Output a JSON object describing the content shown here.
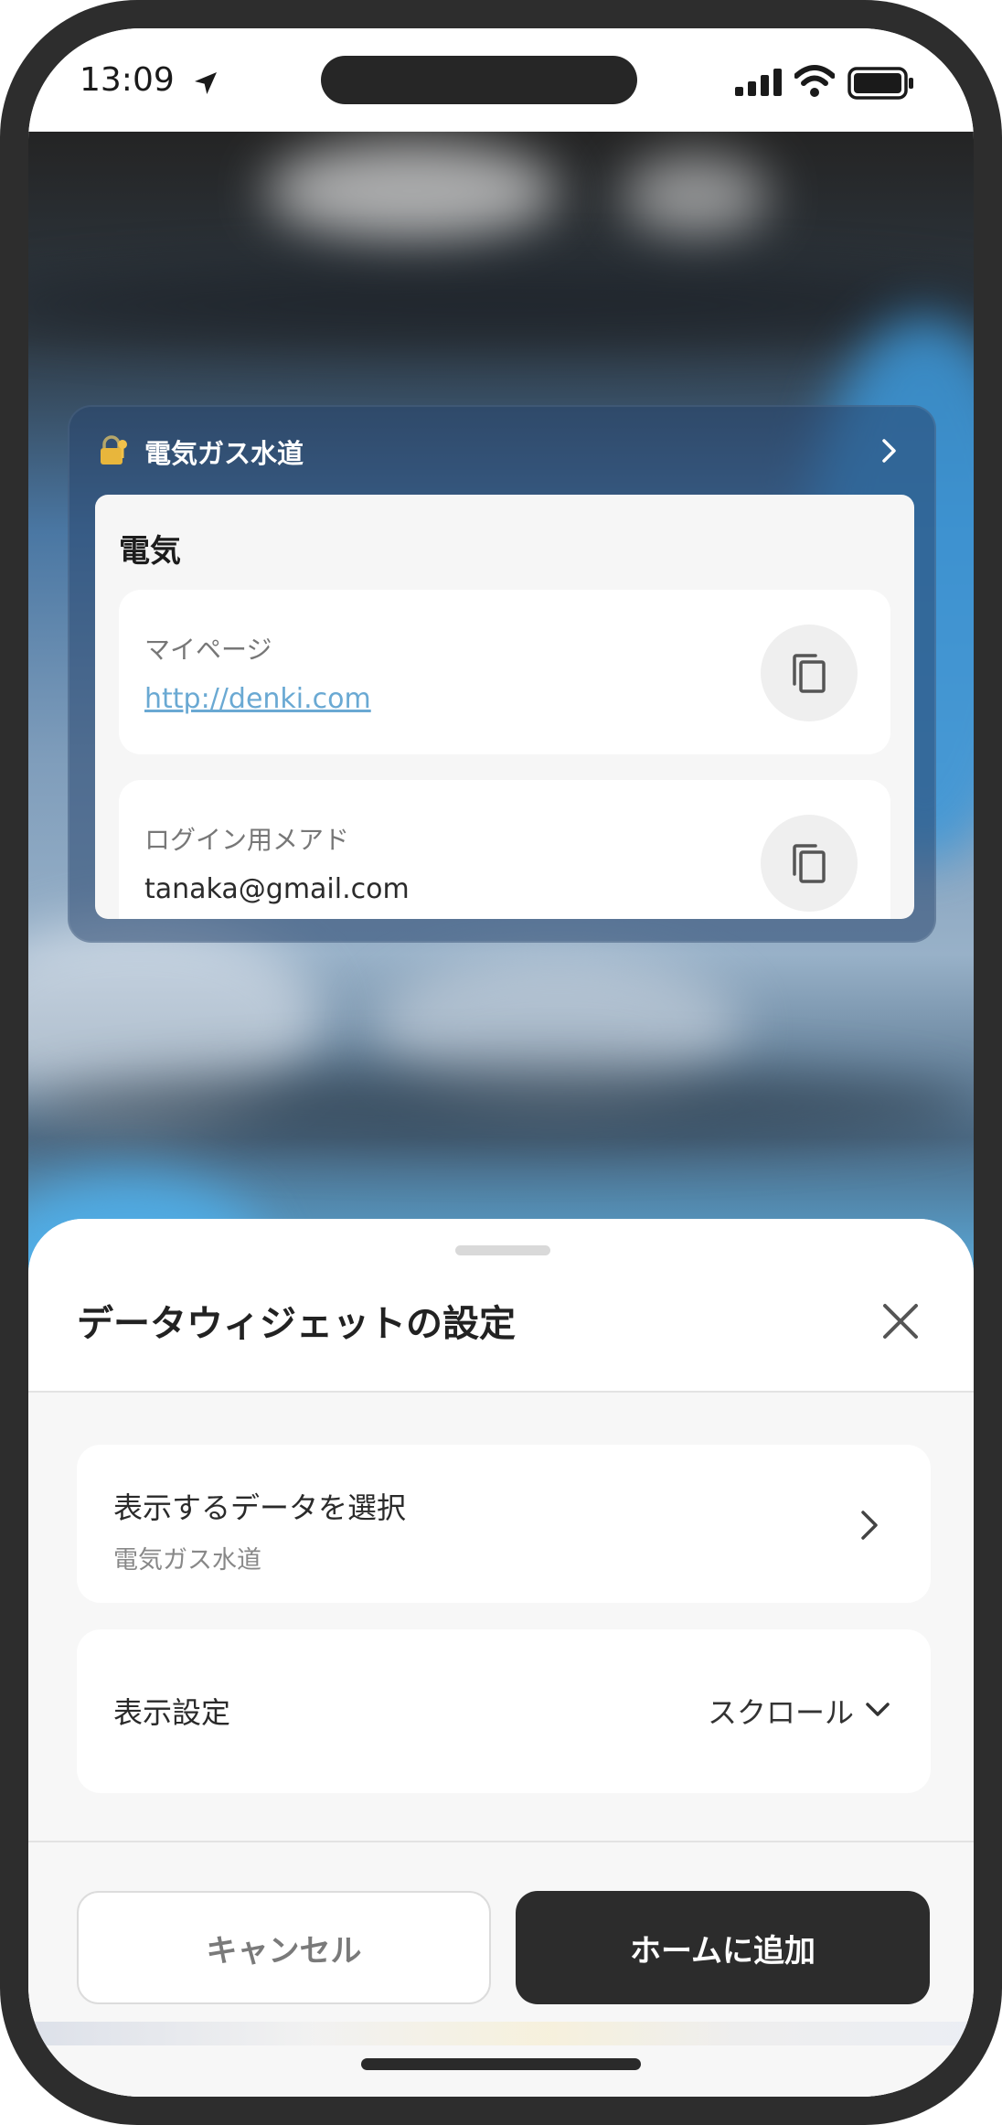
{
  "status_bar": {
    "time": "13:09"
  },
  "widget": {
    "icon": "lock-key-emoji",
    "title": "電気ガス水道",
    "card_title": "電気",
    "fields": [
      {
        "label": "マイページ",
        "value": "http://denki.com",
        "is_link": true
      },
      {
        "label": "ログイン用メアド",
        "value": "tanaka@gmail.com",
        "is_link": false
      }
    ]
  },
  "sheet": {
    "title": "データウィジェットの設定",
    "data_select": {
      "label": "表示するデータを選択",
      "selected": "電気ガス水道"
    },
    "display_setting": {
      "label": "表示設定",
      "value": "スクロール"
    },
    "buttons": {
      "cancel": "キャンセル",
      "add": "ホームに追加"
    }
  },
  "colors": {
    "primary_button": "#2c2c2c",
    "link": "#6aa9d3",
    "frame": "#2d2d2d"
  }
}
